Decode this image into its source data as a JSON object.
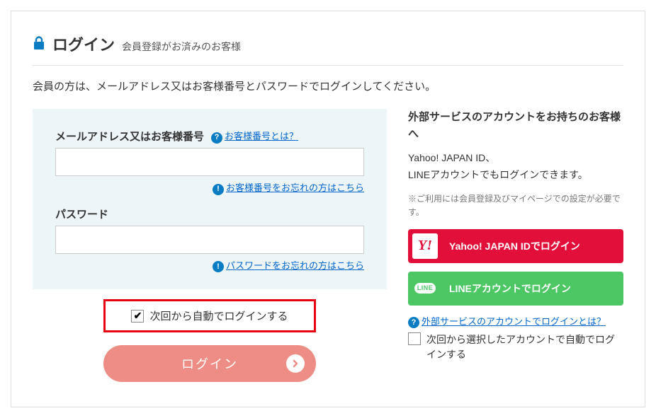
{
  "header": {
    "title": "ログイン",
    "subtitle": "会員登録がお済みのお客様"
  },
  "instruction": "会員の方は、メールアドレス又はお客様番号とパスワードでログインしてください。",
  "form": {
    "id_label": "メールアドレス又はお客様番号",
    "id_help_link": "お客様番号とは？",
    "id_value": "",
    "id_forgot_link": "お客様番号をお忘れの方はこちら",
    "pw_label": "パスワード",
    "pw_value": "",
    "pw_forgot_link": "パスワードをお忘れの方はこちら"
  },
  "auto_login": {
    "checked": true,
    "label": "次回から自動でログインする"
  },
  "login_button": "ログイン",
  "external": {
    "heading": "外部サービスのアカウントをお持ちのお客様へ",
    "desc_line1": "Yahoo! JAPAN ID、",
    "desc_line2": "LINEアカウントでもログインできます。",
    "note": "※ご利用には会員登録及びマイページでの設定が必要です。",
    "yahoo_label": "Yahoo! JAPAN IDでログイン",
    "line_label": "LINEアカウントでログイン",
    "help_link": "外部サービスのアカウントでログインとは？",
    "auto_checked": false,
    "auto_label": "次回から選択したアカウントで自動でログインする"
  },
  "colors": {
    "accent_red": "#e60012",
    "button_salmon": "#ee8d85",
    "yahoo_red": "#e30f3b",
    "line_green": "#4cc764",
    "link_blue": "#0066cc",
    "info_blue": "#0a7cc4",
    "form_bg": "#eef5f8"
  }
}
